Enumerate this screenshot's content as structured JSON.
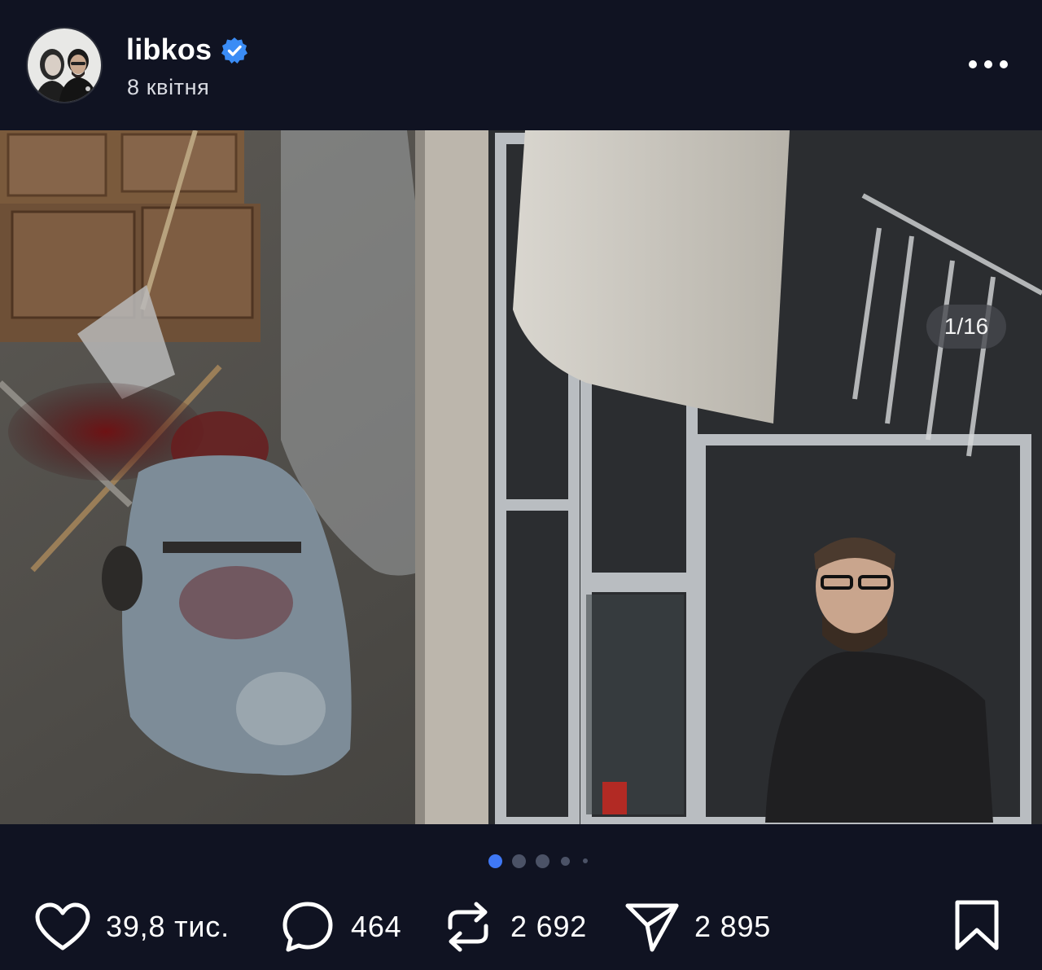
{
  "header": {
    "username": "libkos",
    "date": "8 квітня",
    "avatar_icon": "avatar-icon",
    "verified_icon": "verified-badge-icon",
    "more_icon": "more-horizontal-icon"
  },
  "photo": {
    "counter": "1/16",
    "carousel_index": 1,
    "carousel_total": 16
  },
  "pagination": {
    "visible_dots": 5,
    "active_index": 0
  },
  "actions": {
    "like": {
      "icon": "heart-icon",
      "count": "39,8 тис."
    },
    "comment": {
      "icon": "comment-icon",
      "count": "464"
    },
    "repost": {
      "icon": "repost-icon",
      "count": "2 692"
    },
    "share": {
      "icon": "send-icon",
      "count": "2 895"
    },
    "bookmark": {
      "icon": "bookmark-icon"
    }
  },
  "colors": {
    "background": "#101322",
    "accent": "#3f78f5",
    "verified": "#3a8cf5"
  }
}
